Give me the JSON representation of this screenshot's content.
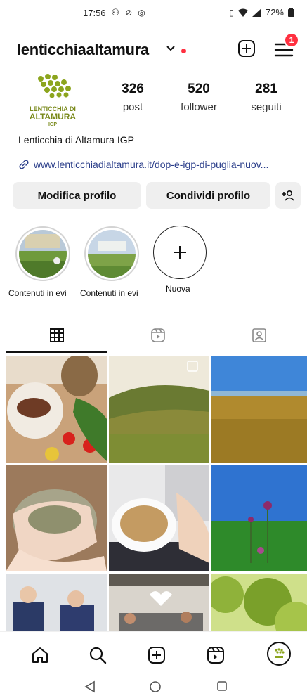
{
  "status_bar": {
    "time": "17:56",
    "battery": "72%"
  },
  "header": {
    "username": "lenticchiaaltamura",
    "notification_count": "1"
  },
  "profile": {
    "avatar_lines": [
      "LENTICCHIA DI",
      "ALTAMURA",
      "IGP"
    ],
    "stats": [
      {
        "value": "326",
        "label": "post"
      },
      {
        "value": "520",
        "label": "follower"
      },
      {
        "value": "281",
        "label": "seguiti"
      }
    ],
    "name": "Lenticchia di Altamura IGP",
    "link": "www.lenticchiadialtamura.it/dop-e-igp-di-puglia-nuov..."
  },
  "buttons": {
    "edit_profile": "Modifica profilo",
    "share_profile": "Condividi profilo"
  },
  "highlights": [
    {
      "label": "Contenuti in evi"
    },
    {
      "label": "Contenuti in evi"
    }
  ],
  "new_highlight_label": "Nuova",
  "colors": {
    "accent_red": "#ff3040",
    "link_blue": "#2b3e8a",
    "button_gray": "#efefef"
  }
}
